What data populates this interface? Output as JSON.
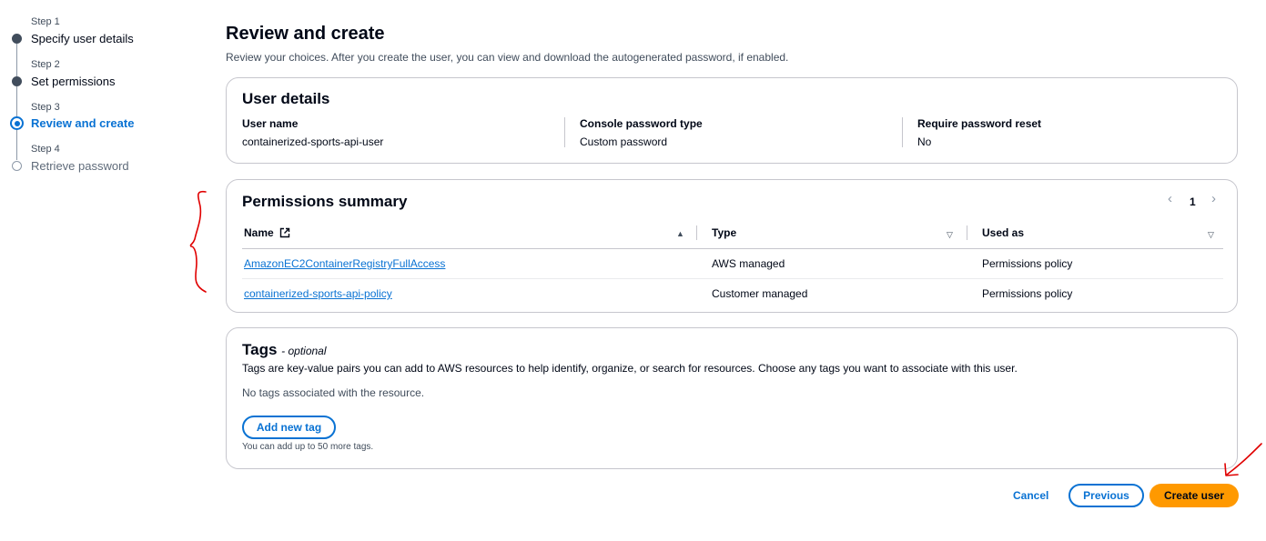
{
  "steps": [
    {
      "num": "Step 1",
      "label": "Specify user details",
      "state": "done"
    },
    {
      "num": "Step 2",
      "label": "Set permissions",
      "state": "done"
    },
    {
      "num": "Step 3",
      "label": "Review and create",
      "state": "active"
    },
    {
      "num": "Step 4",
      "label": "Retrieve password",
      "state": "todo"
    }
  ],
  "page": {
    "title": "Review and create",
    "description": "Review your choices. After you create the user, you can view and download the autogenerated password, if enabled."
  },
  "user_details": {
    "title": "User details",
    "fields": [
      {
        "key": "User name",
        "value": "containerized-sports-api-user"
      },
      {
        "key": "Console password type",
        "value": "Custom password"
      },
      {
        "key": "Require password reset",
        "value": "No"
      }
    ]
  },
  "permissions": {
    "title": "Permissions summary",
    "page_number": "1",
    "columns": [
      "Name",
      "Type",
      "Used as"
    ],
    "rows": [
      {
        "name": "AmazonEC2ContainerRegistryFullAccess",
        "type": "AWS managed",
        "used_as": "Permissions policy"
      },
      {
        "name": "containerized-sports-api-policy",
        "type": "Customer managed",
        "used_as": "Permissions policy"
      }
    ]
  },
  "tags": {
    "title": "Tags",
    "optional": "- optional",
    "description": "Tags are key-value pairs you can add to AWS resources to help identify, organize, or search for resources. Choose any tags you want to associate with this user.",
    "empty_text": "No tags associated with the resource.",
    "add_button": "Add new tag",
    "hint": "You can add up to 50 more tags."
  },
  "footer": {
    "cancel": "Cancel",
    "previous": "Previous",
    "create": "Create user"
  },
  "colors": {
    "accent": "#0972d3",
    "primary_button": "#ff9900",
    "annotation": "#e00000"
  }
}
